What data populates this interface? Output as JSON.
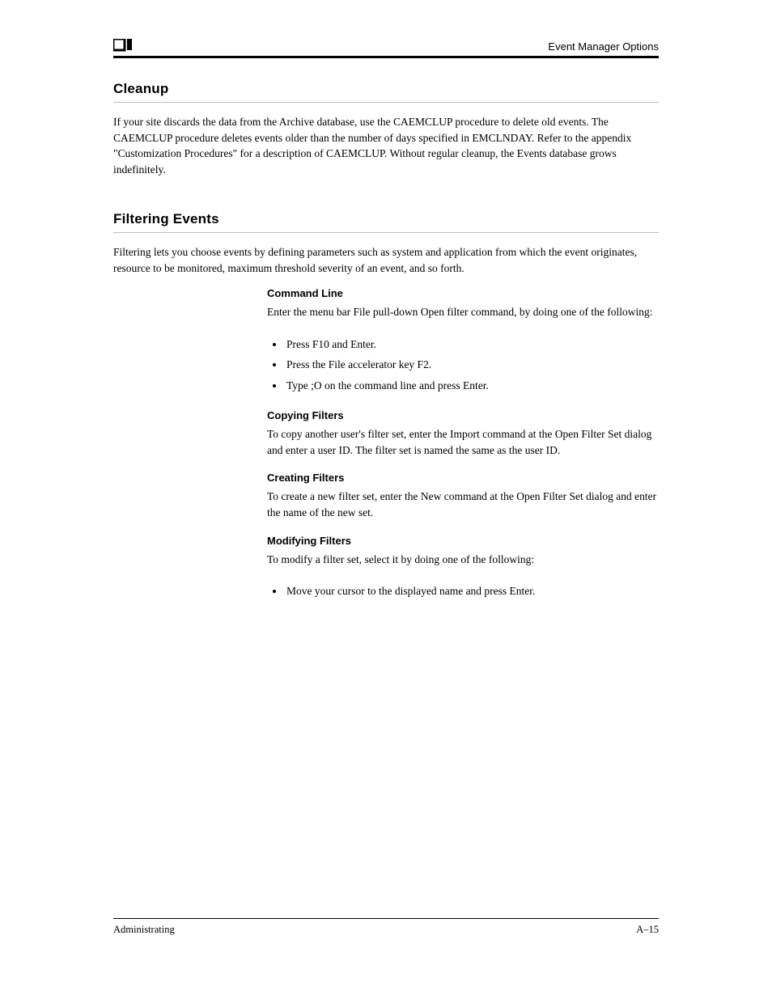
{
  "header": {
    "title": "Event Manager Options"
  },
  "sections": [
    {
      "key": "cleanup",
      "title": "Cleanup",
      "body": "If your site discards the data from the Archive database, use the CAEMCLUP procedure to delete old events. The CAEMCLUP procedure deletes events older than the number of days specified in EMCLNDAY. Refer to the appendix \"Customization Procedures\" for a description of CAEMCLUP. Without regular cleanup, the Events database grows indefinitely."
    },
    {
      "key": "filtering",
      "title": "Filtering Events",
      "body": "Filtering lets you choose events by defining parameters such as system and application from which the event originates, resource to be monitored, maximum threshold severity of an event, and so forth.",
      "blocks": [
        {
          "subhead": "Command Line",
          "para": "Enter the menu bar File pull-down Open filter command, by doing one of the following:",
          "bullets": [
            "Press F10 and Enter.",
            "Press the File accelerator key F2.",
            "Type ;O on the command line and press Enter."
          ]
        },
        {
          "subhead": "Copying Filters",
          "para": "To copy another user's filter set, enter the Import command at the Open Filter Set dialog and enter a user ID. The filter set is named the same as the user ID."
        },
        {
          "subhead": "Creating Filters",
          "para": "To create a new filter set, enter the New command at the Open Filter Set dialog and enter the name of the new set."
        },
        {
          "subhead": "Modifying Filters",
          "para": "To modify a filter set, select it by doing one of the following:",
          "bullets2": [
            "Move your cursor to the displayed name and press Enter."
          ]
        }
      ]
    }
  ],
  "footer": {
    "left": "Administrating",
    "right": "A–15"
  }
}
